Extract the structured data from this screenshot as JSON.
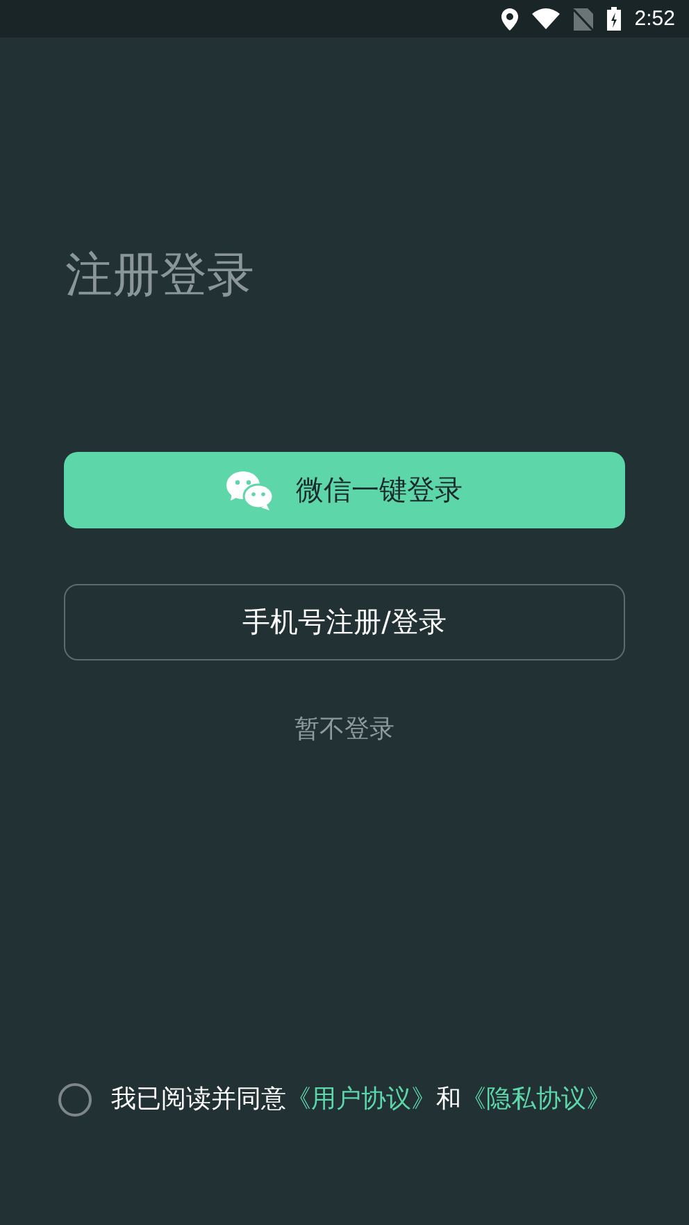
{
  "status_bar": {
    "time": "2:52"
  },
  "title": "注册登录",
  "buttons": [
    {
      "kind": "primary",
      "label": "微信一键登录"
    },
    {
      "kind": "outline",
      "label": "手机号注册/登录"
    }
  ],
  "skip_link": "暂不登录",
  "agreement": {
    "checked": false,
    "parts": [
      {
        "kind": "text",
        "text": "我已阅读并同意"
      },
      {
        "kind": "link",
        "text": "《用户协议》"
      },
      {
        "kind": "text",
        "text": "和"
      },
      {
        "kind": "link",
        "text": "《隐私协议》"
      }
    ]
  }
}
